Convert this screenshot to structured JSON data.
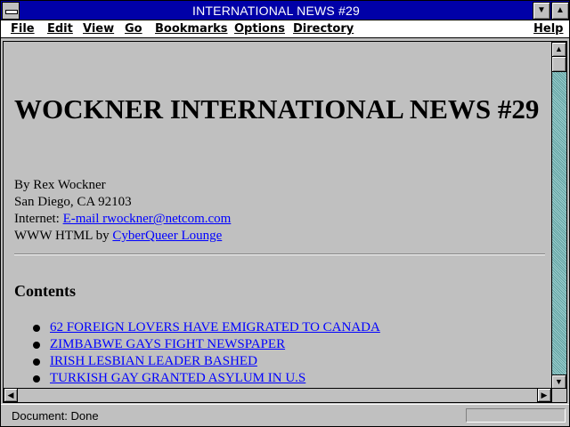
{
  "window": {
    "title": "INTERNATIONAL NEWS #29"
  },
  "menubar": {
    "items": [
      {
        "label": "File",
        "mnemonic": "F"
      },
      {
        "label": "Edit",
        "mnemonic": "E"
      },
      {
        "label": "View",
        "mnemonic": "V"
      },
      {
        "label": "Go",
        "mnemonic": "G"
      },
      {
        "label": "Bookmarks",
        "mnemonic": "B"
      },
      {
        "label": "Options",
        "mnemonic": "O"
      },
      {
        "label": "Directory",
        "mnemonic": "D"
      },
      {
        "label": "Help",
        "mnemonic": "H"
      }
    ]
  },
  "page": {
    "heading": "WOCKNER INTERNATIONAL NEWS #29",
    "byline": {
      "author": "By Rex Wockner",
      "location": "San Diego, CA 92103",
      "internet_label": "Internet:",
      "email_link": "E-mail rwockner@netcom.com",
      "www_label": "WWW HTML by",
      "www_link": "CyberQueer Lounge"
    },
    "contents_heading": "Contents",
    "contents": [
      "62 FOREIGN LOVERS HAVE EMIGRATED TO CANADA",
      "ZIMBABWE GAYS FIGHT NEWSPAPER",
      "IRISH LESBIAN LEADER BASHED",
      "TURKISH GAY GRANTED ASYLUM IN U.S"
    ]
  },
  "statusbar": {
    "text": "Document: Done"
  },
  "colors": {
    "titlebar": "#0000a8",
    "link": "#0000ff",
    "scroll_track": "#80c0c0"
  },
  "icons": [
    "system-menu-icon",
    "minimize-icon",
    "maximize-icon",
    "scroll-up-icon",
    "scroll-down-icon",
    "scroll-left-icon",
    "scroll-right-icon",
    "bullet-icon"
  ]
}
